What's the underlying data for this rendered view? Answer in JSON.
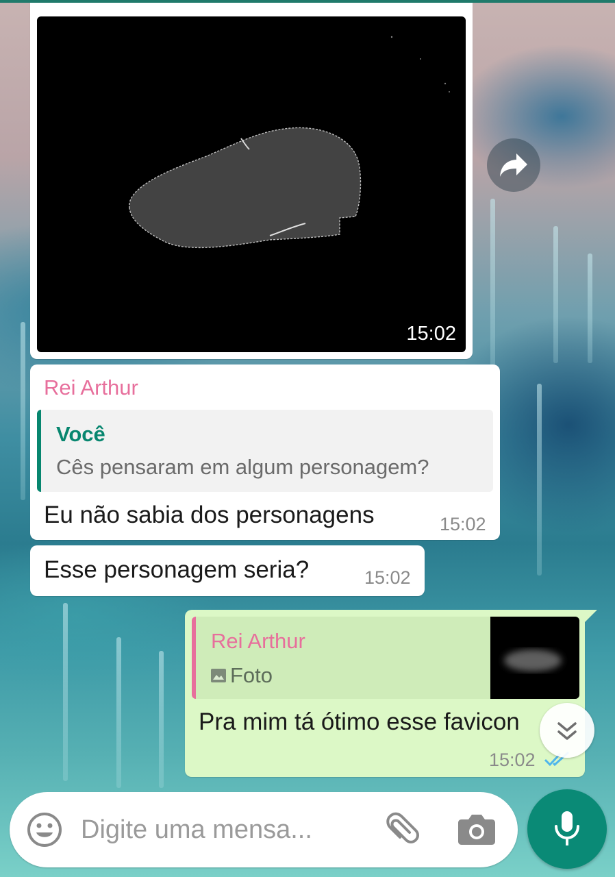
{
  "chat": {
    "image_message": {
      "time": "15:02"
    },
    "reply_message": {
      "sender": "Rei Arthur",
      "quoted_author": "Você",
      "quoted_text": "Cês pensaram em algum personagem?",
      "text": "Eu não sabia dos personagens",
      "time": "15:02"
    },
    "text_message": {
      "text": "Esse personagem seria?",
      "time": "15:02"
    },
    "outgoing_message": {
      "quoted_author": "Rei Arthur",
      "quoted_type": "Foto",
      "text": "Pra mim tá ótimo esse favicon",
      "time": "15:02",
      "status": "read"
    }
  },
  "composer": {
    "placeholder": "Digite uma mensa..."
  },
  "icons": {
    "forward": "forward-icon",
    "scroll_down": "double-chevron-down-icon",
    "emoji": "emoji-icon",
    "attach": "paperclip-icon",
    "camera": "camera-icon",
    "mic": "microphone-icon",
    "photo": "photo-icon",
    "read_receipt": "double-check-icon"
  },
  "colors": {
    "sender_name": "#e76f9c",
    "quoted_author": "#07866f",
    "outgoing_bubble": "#dcf8c6",
    "accent": "#0a8a76",
    "read_check": "#4fb6ec"
  }
}
